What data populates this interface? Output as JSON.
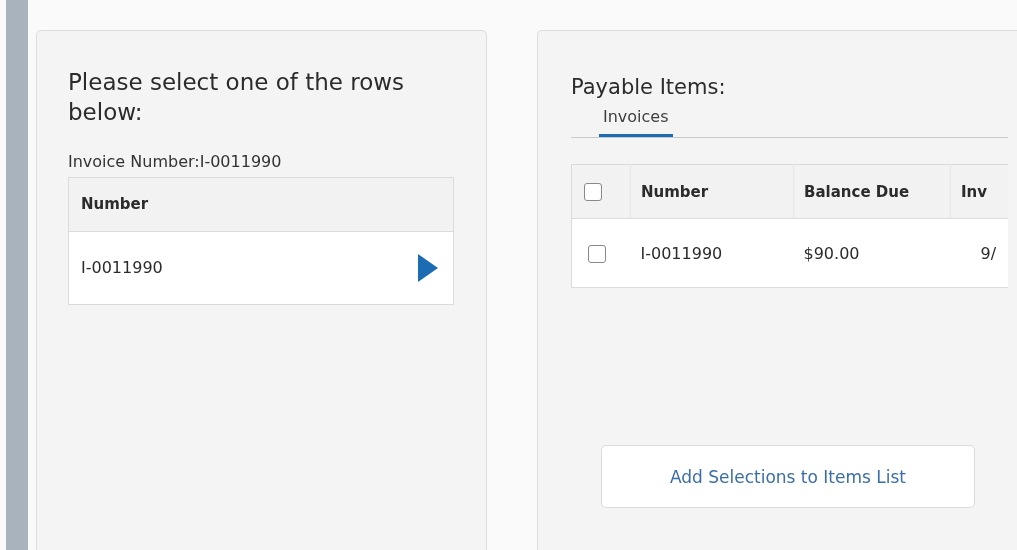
{
  "left_panel": {
    "title": "Please select one of the rows below:",
    "selection_label": "Invoice Number:I-0011990",
    "table": {
      "columns": [
        "Number"
      ],
      "rows": [
        {
          "number": "I-0011990",
          "selected": false
        }
      ]
    }
  },
  "right_panel": {
    "title": "Payable Items:",
    "tabs": [
      {
        "label": "Invoices",
        "selected": true
      }
    ],
    "table": {
      "select_all_checked": false,
      "columns": [
        "Number",
        "Balance Due",
        "Inv"
      ],
      "rows": [
        {
          "checked": false,
          "cells": [
            "I-0011990",
            "$90.00",
            "9/"
          ]
        }
      ]
    },
    "button": "Add Selections to Items List"
  }
}
